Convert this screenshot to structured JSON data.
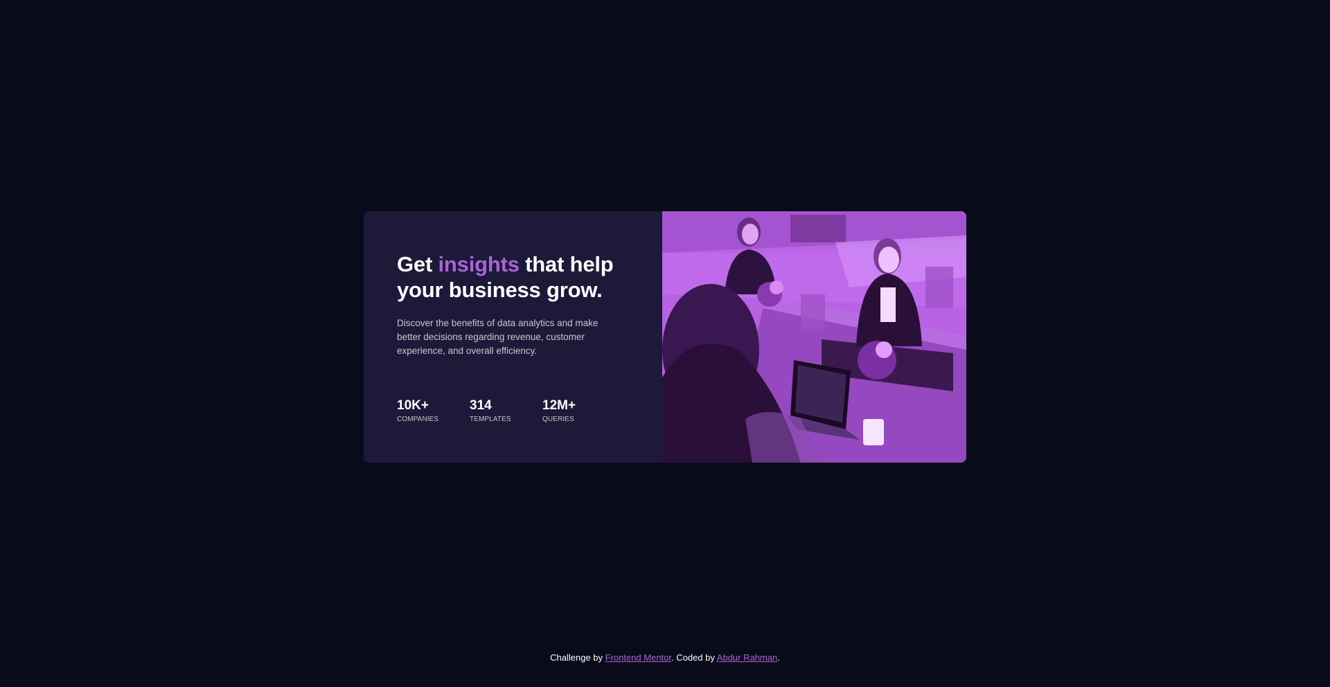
{
  "card": {
    "heading_pre": "Get ",
    "heading_accent": "insights",
    "heading_post": " that help your business grow.",
    "description": "Discover the benefits of data analytics and make better decisions regarding revenue, customer experience, and overall efficiency.",
    "stats": [
      {
        "value": "10K+",
        "label": "Companies"
      },
      {
        "value": "314",
        "label": "Templates"
      },
      {
        "value": "12M+",
        "label": "Queries"
      }
    ]
  },
  "footer": {
    "prefix": "Challenge by ",
    "link1": "Frontend Mentor",
    "middle": ". Coded by ",
    "link2": "Abdur Rahman",
    "suffix": "."
  },
  "colors": {
    "background": "#090b1a",
    "card": "#1c1a38",
    "accent": "#a963d6",
    "image_tint": "#b35ee0"
  }
}
